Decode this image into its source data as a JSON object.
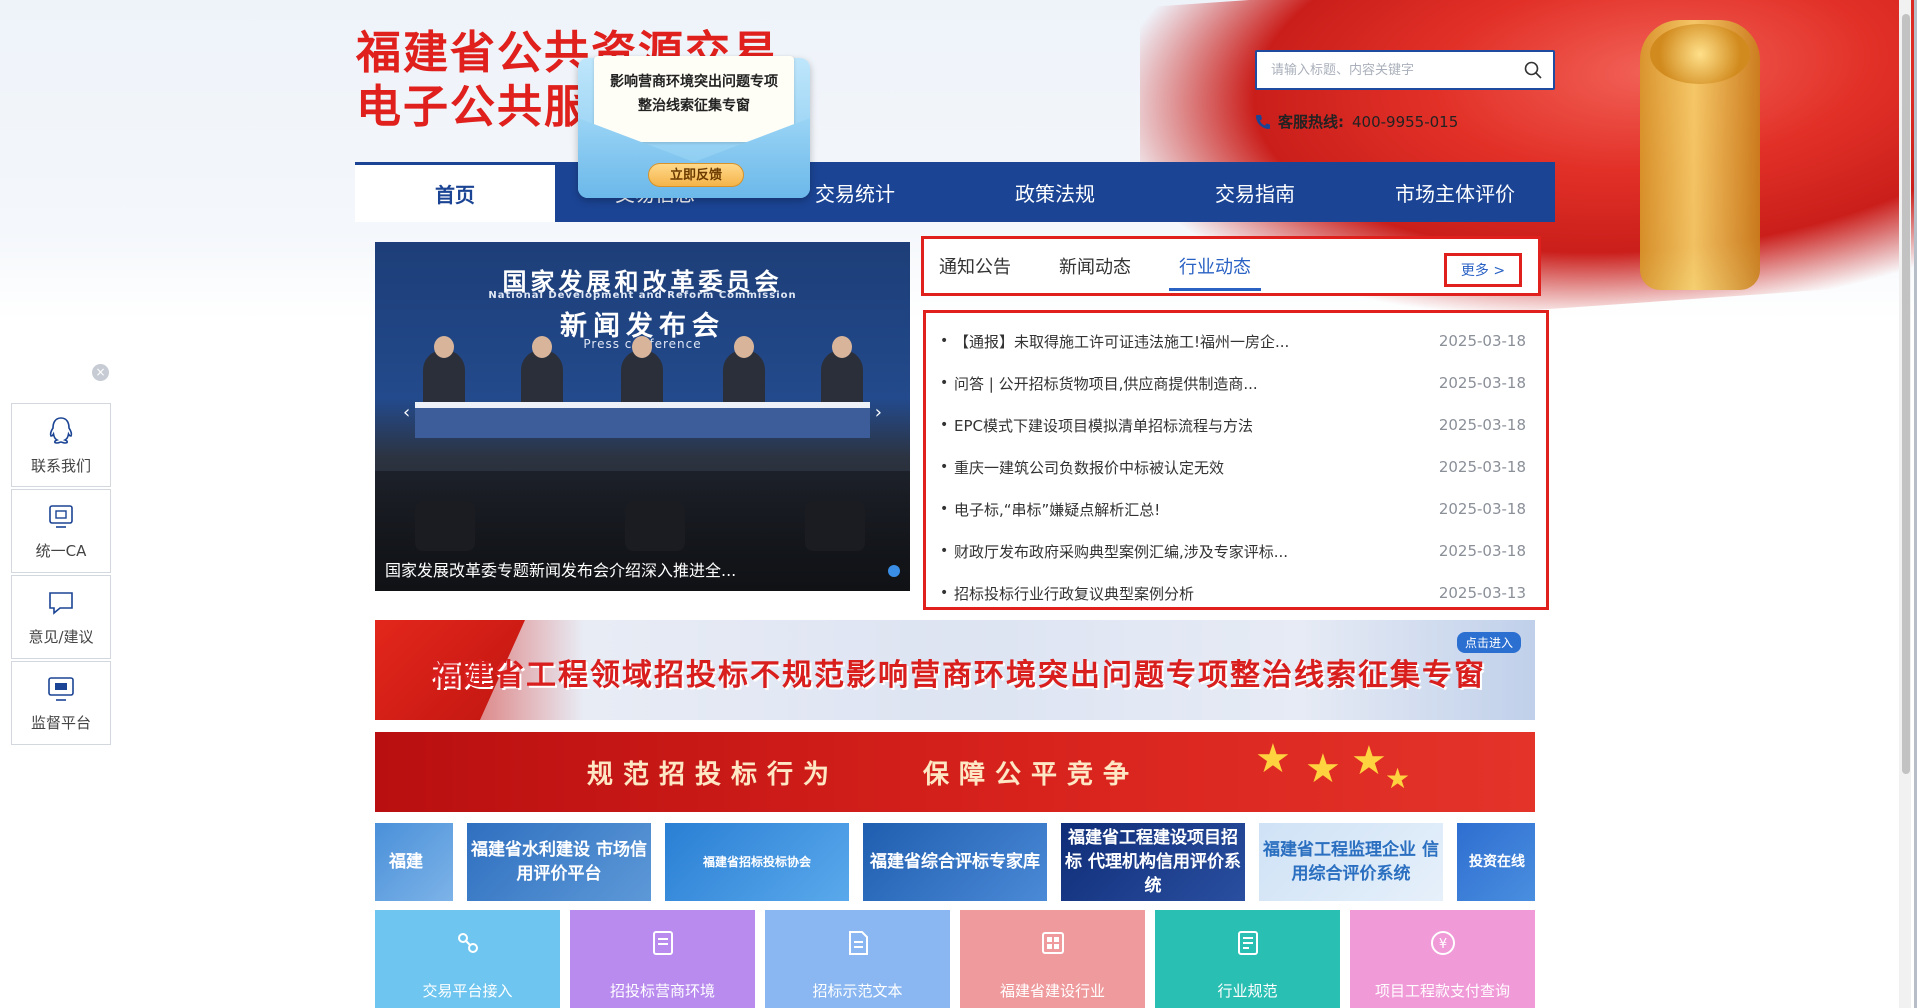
{
  "header": {
    "title_line1": "福建省公共资源交易",
    "title_line2": "电子公共服务平台",
    "search_placeholder": "请输入标题、内容关键字",
    "hotline_label": "客服热线:",
    "hotline_number": "400-9955-015"
  },
  "popup": {
    "text": "影响营商环境突出问题专项整治线索征集专窗",
    "button_label": "立即反馈"
  },
  "nav": {
    "items": [
      {
        "label": "首页",
        "active": true
      },
      {
        "label": "交易信息"
      },
      {
        "label": "交易统计"
      },
      {
        "label": "政策法规"
      },
      {
        "label": "交易指南"
      },
      {
        "label": "市场主体评价"
      }
    ]
  },
  "side_panel": {
    "close_label": "×",
    "items": [
      {
        "label": "联系我们",
        "icon": "qq-icon"
      },
      {
        "label": "统一CA",
        "icon": "ca-icon"
      },
      {
        "label": "意见/建议",
        "icon": "chat-icon"
      },
      {
        "label": "监督平台",
        "icon": "monitor-icon"
      }
    ]
  },
  "carousel": {
    "banner_cn": "国家发展和改革委员会",
    "banner_en": "National Development and Reform Commission",
    "banner_cn2": "新闻发布会",
    "banner_en2": "Press conference",
    "caption": "国家发展改革委专题新闻发布会介绍深入推进全...",
    "prev": "‹",
    "next": "›"
  },
  "news": {
    "tabs": [
      {
        "label": "通知公告"
      },
      {
        "label": "新闻动态"
      },
      {
        "label": "行业动态",
        "active": true
      }
    ],
    "more_label": "更多 >",
    "items": [
      {
        "title": "【通报】未取得施工许可证违法施工!福州一房企...",
        "date": "2025-03-18"
      },
      {
        "title": "问答 | 公开招标货物项目,供应商提供制造商...",
        "date": "2025-03-18"
      },
      {
        "title": "EPC模式下建设项目模拟清单招标流程与方法",
        "date": "2025-03-18"
      },
      {
        "title": "重庆一建筑公司负数报价中标被认定无效",
        "date": "2025-03-18"
      },
      {
        "title": "电子标,“串标”嫌疑点解析汇总!",
        "date": "2025-03-18"
      },
      {
        "title": "财政厅发布政府采购典型案例汇编,涉及专家评标...",
        "date": "2025-03-18"
      },
      {
        "title": "招标投标行业行政复议典型案例分析",
        "date": "2025-03-13"
      }
    ]
  },
  "banners": {
    "banner1_text": "福建省工程领域招投标不规范影响营商环境突出问题专项整治线索征集专窗",
    "banner1_enter": "点击进入",
    "banner2_left": "规范招投标行为",
    "banner2_right": "保障公平竞争"
  },
  "links": [
    {
      "label": "福建"
    },
    {
      "label": "福建省水利建设 市场信用评价平台"
    },
    {
      "label": "福建省招标投标协会"
    },
    {
      "label": "福建省综合评标专家库"
    },
    {
      "label": "福建省工程建设项目招标 代理机构信用评价系统"
    },
    {
      "label": "福建省工程监理企业 信用综合评价系统"
    },
    {
      "label": "投资在线"
    }
  ],
  "services": [
    {
      "label": "交易平台接入"
    },
    {
      "label": "招投标营商环境"
    },
    {
      "label": "招标示范文本"
    },
    {
      "label": "福建省建设行业"
    },
    {
      "label": "行业规范"
    },
    {
      "label": "项目工程款支付查询"
    }
  ],
  "colors": {
    "primary_blue": "#1b4494",
    "accent_red": "#e0201c",
    "link_blue": "#2a62c4"
  }
}
